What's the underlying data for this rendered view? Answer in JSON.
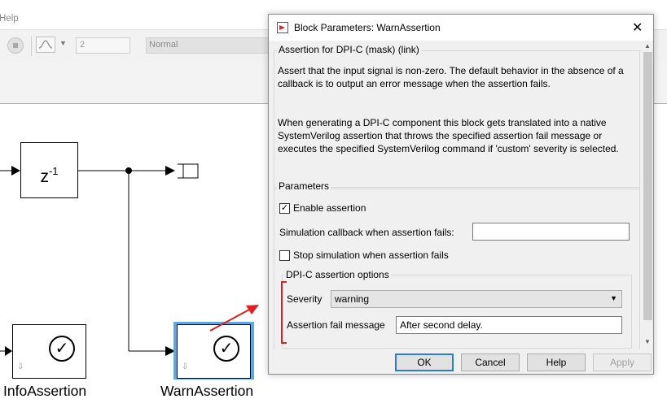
{
  "menubar": {
    "help_label": "Help"
  },
  "toolbar": {
    "stop_time_value": "2",
    "sim_mode_value": "Normal"
  },
  "diagram": {
    "unit_delay": {
      "base": "z",
      "exponent": "-1"
    },
    "blocks": [
      {
        "label": "InfoAssertion",
        "symbol": "✓",
        "port_glyph": "⇩"
      },
      {
        "label": "WarnAssertion",
        "symbol": "✓",
        "port_glyph": "⇩"
      }
    ],
    "selection_color": "#5aa8e6",
    "annotation_color": "#e02020"
  },
  "dialog": {
    "title": "Block Parameters: WarnAssertion",
    "mask_group_title": "Assertion for DPI-C (mask) (link)",
    "description_1": "Assert that the input signal is non-zero. The default behavior in the absence of a callback is to output an error message when the assertion fails.",
    "description_2": "When generating a DPI-C component this block gets translated into a native SystemVerilog assertion that throws the specified assertion fail message or executes the specified SystemVerilog command if 'custom' severity is selected.",
    "parameters_title": "Parameters",
    "enable_assertion": {
      "label": "Enable assertion",
      "checked": true,
      "mark": "✓"
    },
    "sim_callback": {
      "label": "Simulation callback when assertion fails:",
      "value": ""
    },
    "stop_sim": {
      "label": "Stop simulation when assertion fails",
      "checked": false
    },
    "dpic_group_title": "DPI-C assertion options",
    "severity": {
      "label": "Severity",
      "value": "warning"
    },
    "fail_message": {
      "label": "Assertion fail message",
      "value": "After second delay."
    },
    "buttons": {
      "ok": "OK",
      "cancel": "Cancel",
      "help": "Help",
      "apply": "Apply"
    }
  }
}
